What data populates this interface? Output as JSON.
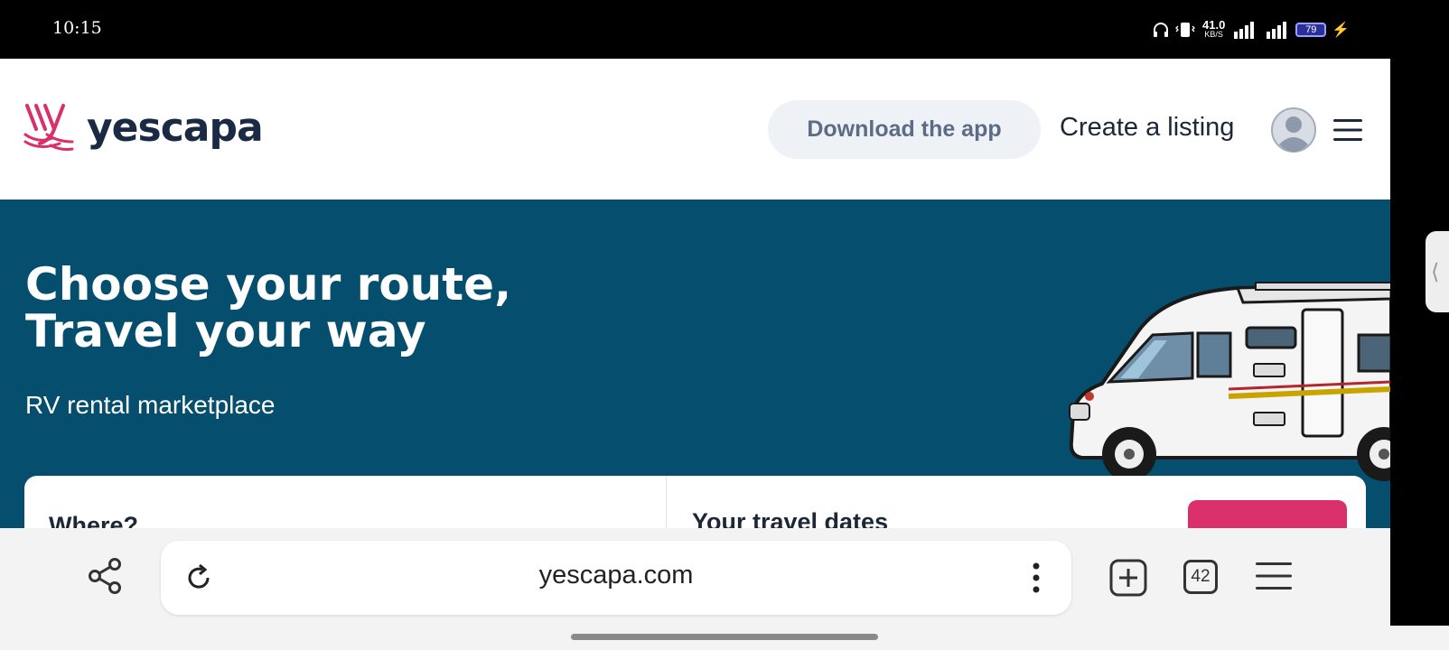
{
  "status_bar": {
    "time": "10:15",
    "net_speed_value": "41.0",
    "net_speed_unit": "KB/S",
    "network_type": "4G",
    "battery": "79",
    "icons": [
      "headphones-icon",
      "vibrate-icon",
      "signal-icon",
      "wifi-signal-icon",
      "battery-icon",
      "charging-icon"
    ]
  },
  "header": {
    "logo_text": "yescapa",
    "download_app_label": "Download the app",
    "create_listing_label": "Create a listing"
  },
  "hero": {
    "title": "Choose your route,\nTravel your way",
    "subtitle": "RV rental marketplace"
  },
  "search": {
    "where_label": "Where?",
    "dates_label": "Your travel dates"
  },
  "browser": {
    "url": "yescapa.com",
    "tab_count": "42"
  },
  "colors": {
    "brand_pink": "#d92f6a",
    "hero_bg": "#064e6d",
    "logo_dark": "#1a2a44"
  }
}
